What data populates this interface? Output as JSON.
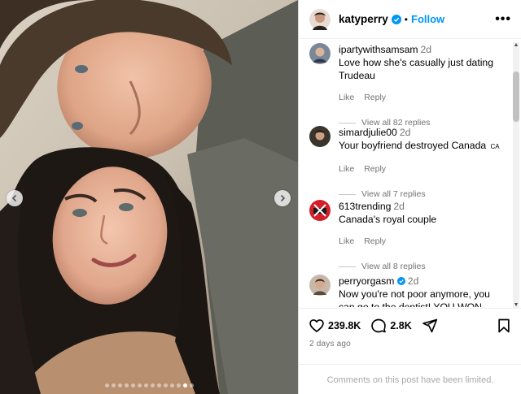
{
  "post": {
    "username": "katyperry",
    "follow_label": "Follow",
    "separator": "•",
    "more_label": "•••",
    "carousel": {
      "total": 14,
      "active_index": 12
    }
  },
  "comments": [
    {
      "user": "ipartywithsamsam",
      "time": "2d",
      "text": "Love how she's casually just dating Trudeau",
      "like": "Like",
      "reply": "Reply",
      "replies": "View all 82 replies",
      "verified": false
    },
    {
      "user": "simardjulie00",
      "time": "2d",
      "text": "Your boyfriend destroyed Canada",
      "flag": "CA",
      "like": "Like",
      "reply": "Reply",
      "replies": "View all 7 replies",
      "verified": false
    },
    {
      "user": "613trending",
      "time": "2d",
      "text": "Canada's royal couple",
      "like": "Like",
      "reply": "Reply",
      "replies": "View all 8 replies",
      "verified": false
    },
    {
      "user": "perryorgasm",
      "time": "2d",
      "text": "Now you're not poor anymore, you can go to the dentist! YOU WON",
      "verified": true
    }
  ],
  "stats": {
    "likes": "239.8K",
    "comments": "2.8K",
    "date": "2 days ago"
  },
  "footer": {
    "limited": "Comments on this post have been limited."
  },
  "colors": {
    "accent": "#0095f6",
    "muted": "#737373"
  }
}
